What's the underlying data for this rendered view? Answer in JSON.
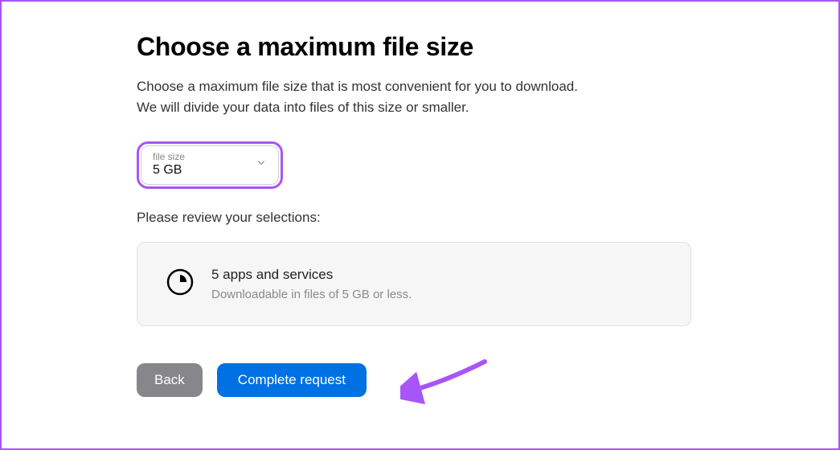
{
  "header": {
    "title": "Choose a maximum file size",
    "desc_line1": "Choose a maximum file size that is most convenient for you to download.",
    "desc_line2": "We will divide your data into files of this size or smaller."
  },
  "dropdown": {
    "label": "file size",
    "value": "5 GB"
  },
  "review": {
    "prompt": "Please review your selections:",
    "title": "5 apps and services",
    "subtitle": "Downloadable in files of 5 GB or less."
  },
  "buttons": {
    "back": "Back",
    "complete": "Complete request"
  }
}
